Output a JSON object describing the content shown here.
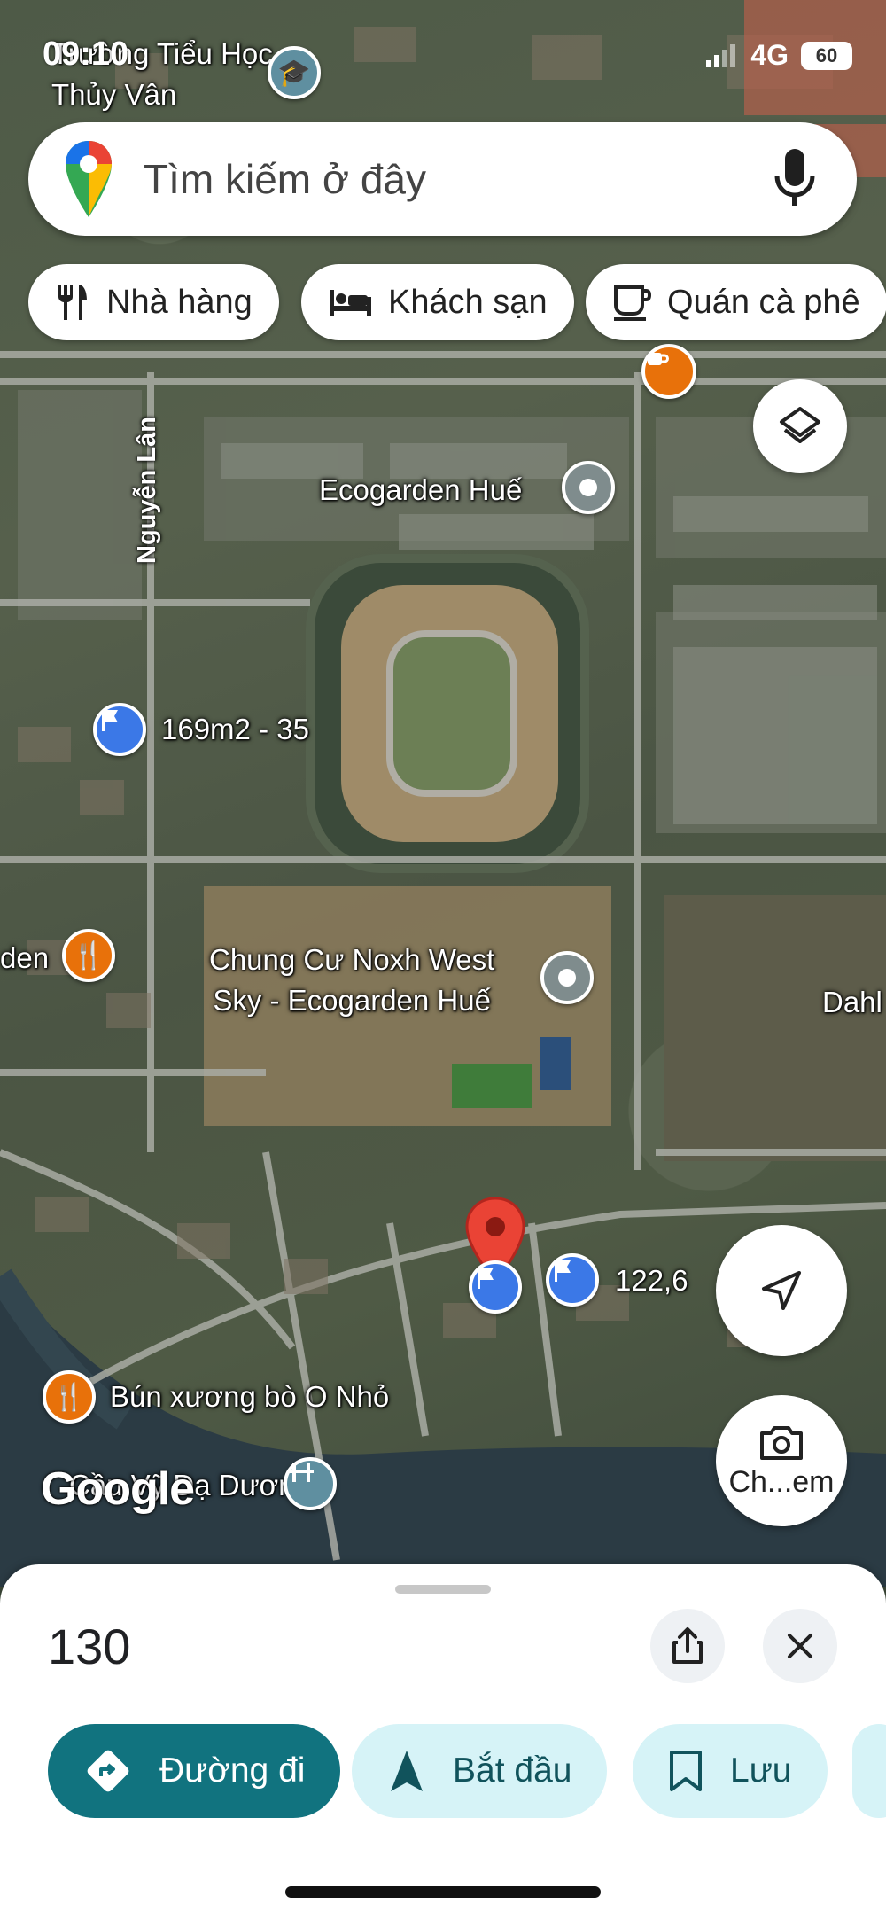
{
  "status": {
    "time": "09:10",
    "network": "4G",
    "battery": "60"
  },
  "search": {
    "placeholder": "Tìm kiếm ở đây"
  },
  "chips": [
    {
      "label": "Nhà hàng",
      "icon": "restaurant-icon"
    },
    {
      "label": "Khách sạn",
      "icon": "hotel-icon"
    },
    {
      "label": "Quán cà phê",
      "icon": "coffee-icon"
    }
  ],
  "map": {
    "labels": {
      "school": "Trường Tiểu Học Thủy Vân",
      "ecogarden": "Ecogarden Huế",
      "lot": "169m2 - 35",
      "road": "Nguyễn Lân",
      "den": "den",
      "apartment_line1": "Chung Cư Noxh West",
      "apartment_line2": "Sky - Ecogarden Huế",
      "dahl": "Dahl",
      "lot2": "122,6",
      "restaurant": "Bún xương bò O Nhỏ",
      "bridge": "Cầu Vỹ Dạ Dương"
    },
    "attribution": "Google",
    "camera_label": "Ch...em"
  },
  "sheet": {
    "title": "130",
    "actions": [
      {
        "label": "Đường đi",
        "icon": "directions-icon"
      },
      {
        "label": "Bắt đầu",
        "icon": "navigation-icon"
      },
      {
        "label": "Lưu",
        "icon": "bookmark-icon"
      }
    ]
  },
  "colors": {
    "accent": "#11737f",
    "secondary_chip": "#d6f3f7",
    "pin_blue": "#3b78e7",
    "pin_red": "#ea4335"
  }
}
